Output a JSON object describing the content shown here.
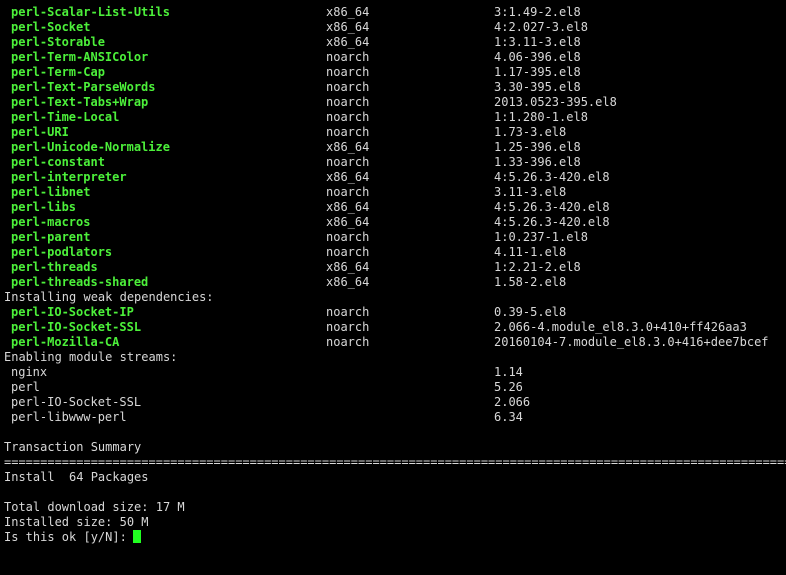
{
  "packages": [
    {
      "name": "perl-Scalar-List-Utils",
      "arch": "x86_64",
      "version": "3:1.49-2.el8"
    },
    {
      "name": "perl-Socket",
      "arch": "x86_64",
      "version": "4:2.027-3.el8"
    },
    {
      "name": "perl-Storable",
      "arch": "x86_64",
      "version": "1:3.11-3.el8"
    },
    {
      "name": "perl-Term-ANSIColor",
      "arch": "noarch",
      "version": "4.06-396.el8"
    },
    {
      "name": "perl-Term-Cap",
      "arch": "noarch",
      "version": "1.17-395.el8"
    },
    {
      "name": "perl-Text-ParseWords",
      "arch": "noarch",
      "version": "3.30-395.el8"
    },
    {
      "name": "perl-Text-Tabs+Wrap",
      "arch": "noarch",
      "version": "2013.0523-395.el8"
    },
    {
      "name": "perl-Time-Local",
      "arch": "noarch",
      "version": "1:1.280-1.el8"
    },
    {
      "name": "perl-URI",
      "arch": "noarch",
      "version": "1.73-3.el8"
    },
    {
      "name": "perl-Unicode-Normalize",
      "arch": "x86_64",
      "version": "1.25-396.el8"
    },
    {
      "name": "perl-constant",
      "arch": "noarch",
      "version": "1.33-396.el8"
    },
    {
      "name": "perl-interpreter",
      "arch": "x86_64",
      "version": "4:5.26.3-420.el8"
    },
    {
      "name": "perl-libnet",
      "arch": "noarch",
      "version": "3.11-3.el8"
    },
    {
      "name": "perl-libs",
      "arch": "x86_64",
      "version": "4:5.26.3-420.el8"
    },
    {
      "name": "perl-macros",
      "arch": "x86_64",
      "version": "4:5.26.3-420.el8"
    },
    {
      "name": "perl-parent",
      "arch": "noarch",
      "version": "1:0.237-1.el8"
    },
    {
      "name": "perl-podlators",
      "arch": "noarch",
      "version": "4.11-1.el8"
    },
    {
      "name": "perl-threads",
      "arch": "x86_64",
      "version": "1:2.21-2.el8"
    },
    {
      "name": "perl-threads-shared",
      "arch": "x86_64",
      "version": "1.58-2.el8"
    }
  ],
  "weak_header": "Installing weak dependencies:",
  "weak_packages": [
    {
      "name": "perl-IO-Socket-IP",
      "arch": "noarch",
      "version": "0.39-5.el8"
    },
    {
      "name": "perl-IO-Socket-SSL",
      "arch": "noarch",
      "version": "2.066-4.module_el8.3.0+410+ff426aa3"
    },
    {
      "name": "perl-Mozilla-CA",
      "arch": "noarch",
      "version": "20160104-7.module_el8.3.0+416+dee7bcef"
    }
  ],
  "modules_header": "Enabling module streams:",
  "modules": [
    {
      "name": "nginx",
      "stream": "1.14"
    },
    {
      "name": "perl",
      "stream": "5.26"
    },
    {
      "name": "perl-IO-Socket-SSL",
      "stream": "2.066"
    },
    {
      "name": "perl-libwww-perl",
      "stream": "6.34"
    }
  ],
  "summary_title": "Transaction Summary",
  "separator": "==================================================================================================================================",
  "install_line": "Install  64 Packages",
  "download_size": "Total download size: 17 M",
  "installed_size": "Installed size: 50 M",
  "prompt": "Is this ok [y/N]:",
  "colors": {
    "background": "#000000",
    "text": "#d8d8d8",
    "package": "#4cf03a",
    "cursor": "#21ff21"
  }
}
